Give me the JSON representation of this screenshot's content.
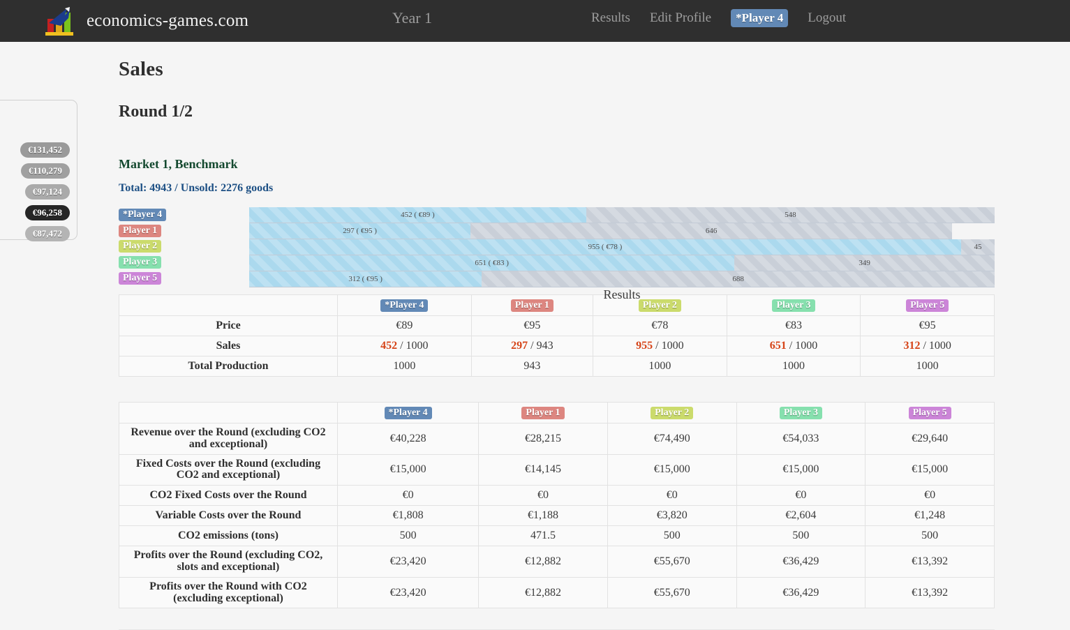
{
  "navbar": {
    "brand": "economics-games.com",
    "logo_icon": "bar-chart-arrow-logo",
    "year": "Year 1",
    "links": [
      {
        "label": "Results",
        "active": false
      },
      {
        "label": "Edit Profile",
        "active": false
      },
      {
        "label": "*Player 4",
        "active": true
      },
      {
        "label": "Logout",
        "active": false
      }
    ],
    "active_player_bg": "#6289b6"
  },
  "side_panel": {
    "badges": [
      {
        "value": "€131,452",
        "color": "#9a9a9a"
      },
      {
        "value": "€110,279",
        "color": "#a0a0a0"
      },
      {
        "value": "€97,124",
        "color": "#aaaaaa"
      },
      {
        "value": "€96,258",
        "color": "#262626"
      },
      {
        "value": "€87,472",
        "color": "#b4b4b4"
      }
    ]
  },
  "main": {
    "page_title": "Sales",
    "round_title": "Round 1/2",
    "market_title": "Market 1, Benchmark",
    "market_title_color": "#14492f",
    "market_total": "Total: 4943  / Unsold: 2276 goods",
    "market_total_color": "#1c4f84",
    "chart_caption": "Results"
  },
  "players": [
    {
      "name": "*Player 4",
      "color": "#6289b6"
    },
    {
      "name": "Player 1",
      "color": "#dd8680"
    },
    {
      "name": "Player 2",
      "color": "#cbdb6c"
    },
    {
      "name": "Player 3",
      "color": "#86e0ae"
    },
    {
      "name": "Player 5",
      "color": "#cc85d8"
    }
  ],
  "chart_data": {
    "type": "bar",
    "title": "Results",
    "orientation": "horizontal",
    "stacked": true,
    "xlim": [
      0,
      1000
    ],
    "grid": false,
    "legend": "left-row-labels",
    "categories": [
      "*Player 4",
      "Player 1",
      "Player 2",
      "Player 3",
      "Player 5"
    ],
    "series": [
      {
        "name": "Sold",
        "color": "#abd9ee",
        "values": [
          452,
          297,
          955,
          651,
          312
        ]
      },
      {
        "name": "Unsold",
        "color": "#c9cfd8",
        "values": [
          548,
          646,
          45,
          349,
          688
        ]
      }
    ],
    "bars": [
      {
        "category": "*Player 4",
        "sold": 452,
        "unsold": 548,
        "total": 1000,
        "price": "€89",
        "sold_label": "452 ( €89 )",
        "unsold_label": "548"
      },
      {
        "category": "Player 1",
        "sold": 297,
        "unsold": 646,
        "total": 943,
        "price": "€95",
        "sold_label": "297 ( €95 )",
        "unsold_label": "646"
      },
      {
        "category": "Player 2",
        "sold": 955,
        "unsold": 45,
        "total": 1000,
        "price": "€78",
        "sold_label": "955 ( €78 )",
        "unsold_label": "45"
      },
      {
        "category": "Player 3",
        "sold": 651,
        "unsold": 349,
        "total": 1000,
        "price": "€83",
        "sold_label": "651 ( €83 )",
        "unsold_label": "349"
      },
      {
        "category": "Player 5",
        "sold": 312,
        "unsold": 688,
        "total": 1000,
        "price": "€95",
        "sold_label": "312 ( €95 )",
        "unsold_label": "688"
      }
    ]
  },
  "results_table": {
    "rows": [
      {
        "label": "Price",
        "values": [
          "€89",
          "€95",
          "€78",
          "€83",
          "€95"
        ]
      },
      {
        "label": "Sales",
        "sold": [
          "452",
          "297",
          "955",
          "651",
          "312"
        ],
        "totals": [
          "1000",
          "943",
          "1000",
          "1000",
          "1000"
        ]
      },
      {
        "label": "Total Production",
        "values": [
          "1000",
          "943",
          "1000",
          "1000",
          "1000"
        ]
      }
    ]
  },
  "financials_table": {
    "rows": [
      {
        "label": "Revenue over the Round (excluding CO2 and exceptional)",
        "values": [
          "€40,228",
          "€28,215",
          "€74,490",
          "€54,033",
          "€29,640"
        ]
      },
      {
        "label": "Fixed Costs over the Round (excluding CO2 and exceptional)",
        "values": [
          "€15,000",
          "€14,145",
          "€15,000",
          "€15,000",
          "€15,000"
        ]
      },
      {
        "label": "CO2 Fixed Costs over the Round",
        "values": [
          "€0",
          "€0",
          "€0",
          "€0",
          "€0"
        ]
      },
      {
        "label": "Variable Costs over the Round",
        "values": [
          "€1,808",
          "€1,188",
          "€3,820",
          "€2,604",
          "€1,248"
        ]
      },
      {
        "label": "CO2 emissions (tons)",
        "values": [
          "500",
          "471.5",
          "500",
          "500",
          "500"
        ]
      },
      {
        "label": "Profits over the Round (excluding CO2, slots and exceptional)",
        "values": [
          "€23,420",
          "€12,882",
          "€55,670",
          "€36,429",
          "€13,392"
        ]
      },
      {
        "label": "Profits over the Round with CO2 (excluding exceptional)",
        "values": [
          "€23,420",
          "€12,882",
          "€55,670",
          "€36,429",
          "€13,392"
        ]
      }
    ]
  }
}
